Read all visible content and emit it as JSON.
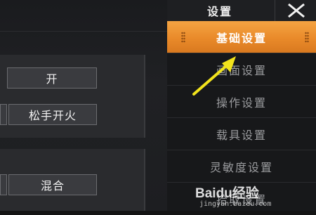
{
  "menu": {
    "title": "设置",
    "close_icon": "close-icon",
    "items": [
      {
        "label": "基础设置",
        "active": true
      },
      {
        "label": "画面设置",
        "active": false
      },
      {
        "label": "操作设置",
        "active": false
      },
      {
        "label": "载具设置",
        "active": false
      },
      {
        "label": "灵敏度设置",
        "active": false
      },
      {
        "label": "拾取设置",
        "active": false
      }
    ]
  },
  "left_panel": {
    "toggle_value": "开",
    "fire_mode_value": "松手开火",
    "mix_value": "混合"
  },
  "watermark": {
    "text": "Baidu经验",
    "url": "jingyan.baidu.com"
  },
  "colors": {
    "accent": "#ee922f",
    "arrow": "#f2e31c"
  }
}
